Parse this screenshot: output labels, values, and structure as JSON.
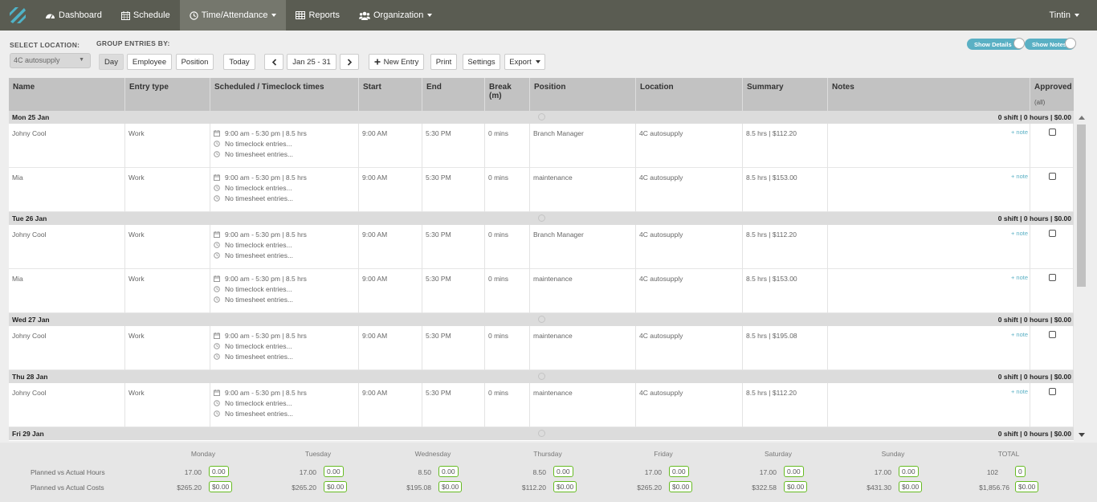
{
  "nav": {
    "items": [
      {
        "label": "Dashboard",
        "icon": "dashboard-icon"
      },
      {
        "label": "Schedule",
        "icon": "calendar-icon"
      },
      {
        "label": "Time/Attendance",
        "icon": "clock-icon"
      },
      {
        "label": "Reports",
        "icon": "table-icon"
      },
      {
        "label": "Organization",
        "icon": "group-icon"
      }
    ],
    "user": "Tintin",
    "accent": "#5a5c52"
  },
  "toolbar": {
    "select_location_label": "SELECT LOCATION:",
    "location_value": "4C autosupply",
    "group_label": "GROUP ENTRIES BY:",
    "group_options": [
      "Day",
      "Employee",
      "Position"
    ],
    "today": "Today",
    "date_range": "Jan 25 - 31",
    "new_entry": "New Entry",
    "print": "Print",
    "settings": "Settings",
    "export": "Export",
    "show_details": "Show Details",
    "show_notes": "Show Notes"
  },
  "table": {
    "headers": {
      "name": "Name",
      "entry_type": "Entry type",
      "sched": "Scheduled / Timeclock times",
      "start": "Start",
      "end": "End",
      "break": "Break (m)",
      "position": "Position",
      "location": "Location",
      "summary": "Summary",
      "notes": "Notes",
      "approved": "Approved",
      "approved_sub": "(all)"
    },
    "note_link": "+ note",
    "no_timeclock": "No timeclock entries...",
    "no_timesheet": "No timesheet entries...",
    "days": [
      {
        "label": "Mon 25 Jan",
        "summary": "0 shift | 0 hours | $0.00"
      },
      {
        "label": "Tue 26 Jan",
        "summary": "0 shift | 0 hours | $0.00"
      },
      {
        "label": "Wed 27 Jan",
        "summary": "0 shift | 0 hours | $0.00"
      },
      {
        "label": "Thu 28 Jan",
        "summary": "0 shift | 0 hours | $0.00"
      },
      {
        "label": "Fri 29 Jan",
        "summary": "0 shift | 0 hours | $0.00"
      }
    ],
    "entries": [
      {
        "name": "Johny Cool",
        "type": "Work",
        "sched": "9:00 am - 5:30 pm | 8.5 hrs",
        "start": "9:00 AM",
        "end": "5:30 PM",
        "break": "0 mins",
        "position": "Branch Manager",
        "location": "4C autosupply",
        "summary": "8.5 hrs | $112.20"
      },
      {
        "name": "Mia",
        "type": "Work",
        "sched": "9:00 am - 5:30 pm | 8.5 hrs",
        "start": "9:00 AM",
        "end": "5:30 PM",
        "break": "0 mins",
        "position": "maintenance",
        "location": "4C autosupply",
        "summary": "8.5 hrs | $153.00"
      },
      {
        "name": "Johny Cool",
        "type": "Work",
        "sched": "9:00 am - 5:30 pm | 8.5 hrs",
        "start": "9:00 AM",
        "end": "5:30 PM",
        "break": "0 mins",
        "position": "Branch Manager",
        "location": "4C autosupply",
        "summary": "8.5 hrs | $112.20"
      },
      {
        "name": "Mia",
        "type": "Work",
        "sched": "9:00 am - 5:30 pm | 8.5 hrs",
        "start": "9:00 AM",
        "end": "5:30 PM",
        "break": "0 mins",
        "position": "maintenance",
        "location": "4C autosupply",
        "summary": "8.5 hrs | $153.00"
      },
      {
        "name": "Johny Cool",
        "type": "Work",
        "sched": "9:00 am - 5:30 pm | 8.5 hrs",
        "start": "9:00 AM",
        "end": "5:30 PM",
        "break": "0 mins",
        "position": "maintenance",
        "location": "4C autosupply",
        "summary": "8.5 hrs | $195.08"
      },
      {
        "name": "Johny Cool",
        "type": "Work",
        "sched": "9:00 am - 5:30 pm | 8.5 hrs",
        "start": "9:00 AM",
        "end": "5:30 PM",
        "break": "0 mins",
        "position": "maintenance",
        "location": "4C autosupply",
        "summary": "8.5 hrs | $112.20"
      }
    ]
  },
  "footer": {
    "days": [
      "Monday",
      "Tuesday",
      "Wednesday",
      "Thursday",
      "Friday",
      "Saturday",
      "Sunday",
      "TOTAL"
    ],
    "hours_label": "Planned vs Actual Hours",
    "costs_label": "Planned vs Actual Costs",
    "planned_hours": [
      "17.00",
      "17.00",
      "8.50",
      "8.50",
      "17.00",
      "17.00",
      "17.00",
      "102"
    ],
    "actual_hours": [
      "0.00",
      "0.00",
      "0.00",
      "0.00",
      "0.00",
      "0.00",
      "0.00",
      "0"
    ],
    "planned_costs": [
      "$265.20",
      "$265.20",
      "$195.08",
      "$112.20",
      "$265.20",
      "$322.58",
      "$431.30",
      "$1,856.76"
    ],
    "actual_costs": [
      "$0.00",
      "$0.00",
      "$0.00",
      "$0.00",
      "$0.00",
      "$0.00",
      "$0.00",
      "$0.00"
    ]
  }
}
